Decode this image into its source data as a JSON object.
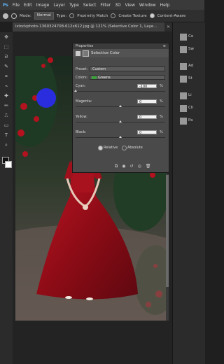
{
  "menu": [
    "File",
    "Edit",
    "Image",
    "Layer",
    "Type",
    "Select",
    "Filter",
    "3D",
    "View",
    "Window",
    "Help"
  ],
  "options": {
    "mode_label": "Mode:",
    "mode_value": "Normal",
    "type_label": "Type:",
    "proximity_label": "Proximity Match",
    "texture_label": "Create Texture",
    "content_aware_label": "Content-Aware"
  },
  "document_tab": "istockphoto-1360324708-612x612.jpg @ 121% (Selective Color 1, Laye...",
  "properties": {
    "panel_title": "Properties",
    "adjustment_title": "Selective Color",
    "preset_label": "Preset:",
    "preset_value": "Custom",
    "colors_label": "Colors:",
    "colors_value": "Greens",
    "sliders": [
      {
        "name": "Cyan",
        "label": "Cyan:",
        "value": "-100",
        "unit": "%"
      },
      {
        "name": "Magenta",
        "label": "Magenta:",
        "value": "0",
        "unit": "%"
      },
      {
        "name": "Yellow",
        "label": "Yellow:",
        "value": "0",
        "unit": "%"
      },
      {
        "name": "Black",
        "label": "Black:",
        "value": "0",
        "unit": "%"
      }
    ],
    "relative_label": "Relative",
    "absolute_label": "Absolute"
  },
  "right_panel": {
    "labels": [
      "Co",
      "Sw",
      "Ad",
      "St",
      "Li",
      "Ch",
      "Pa"
    ]
  },
  "colors": {
    "greens_swatch": "#3aa13a",
    "dress": "#b3121f",
    "brush": "#2c2cff"
  },
  "icons": [
    "move-tool-icon",
    "marquee-tool-icon",
    "lasso-tool-icon",
    "quick-select-icon",
    "crop-tool-icon",
    "eyedropper-icon",
    "healing-brush-icon",
    "brush-tool-icon",
    "clone-stamp-icon",
    "history-brush-icon",
    "eraser-icon",
    "gradient-icon",
    "blur-icon",
    "dodge-icon",
    "pen-icon",
    "type-tool-icon",
    "path-select-icon",
    "shape-icon",
    "hand-icon",
    "zoom-icon"
  ]
}
